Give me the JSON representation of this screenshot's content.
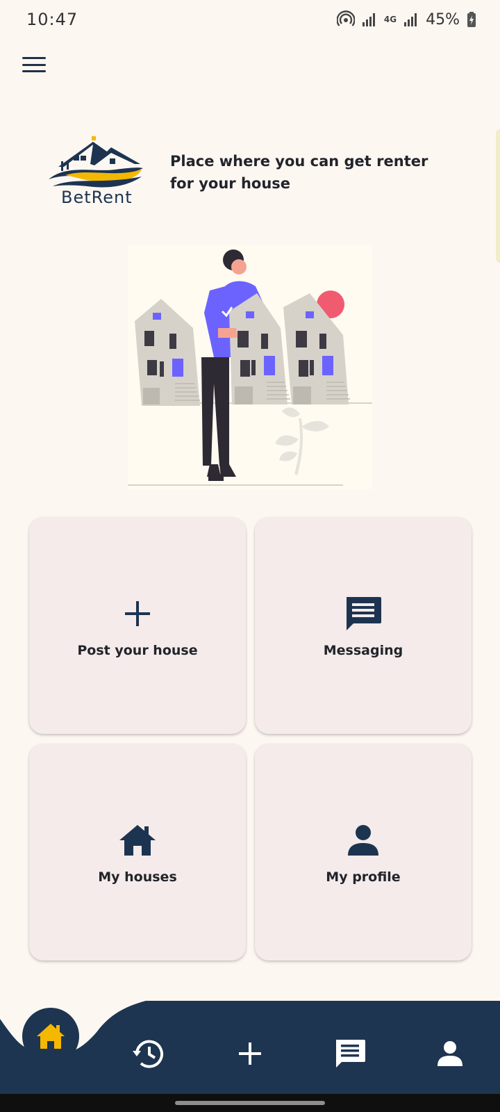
{
  "status_bar": {
    "time": "10:47",
    "network": "4G",
    "battery": "45%"
  },
  "header": {
    "logo_text": "BetRent",
    "tagline": "Place where you can get renter for your house"
  },
  "cards": [
    {
      "label": "Post your house",
      "icon": "add-icon"
    },
    {
      "label": "Messaging",
      "icon": "message-icon"
    },
    {
      "label": "My houses",
      "icon": "house-icon"
    },
    {
      "label": "My profile",
      "icon": "person-icon"
    }
  ],
  "bottom_nav": {
    "items": [
      "home-icon",
      "history-icon",
      "add-icon",
      "message-icon",
      "person-icon"
    ],
    "active": "home-icon"
  },
  "colors": {
    "background": "#fdf7f2",
    "navy": "#1d3550",
    "accent": "#f5b800",
    "card": "#f4ebea",
    "illustration_purple": "#6c63ff",
    "illustration_red": "#f05b70"
  }
}
